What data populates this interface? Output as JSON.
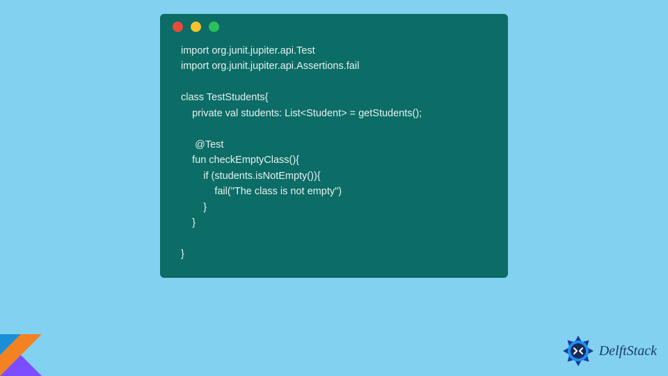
{
  "window": {
    "dots": [
      "red",
      "yellow",
      "green"
    ]
  },
  "code": {
    "lines": [
      "import org.junit.jupiter.api.Test",
      "import org.junit.jupiter.api.Assertions.fail",
      "",
      "class TestStudents{",
      "    private val students: List<Student> = getStudents();",
      "",
      "     @Test",
      "    fun checkEmptyClass(){",
      "        if (students.isNotEmpty()){",
      "            fail(\"The class is not empty\")",
      "        }",
      "    }",
      "",
      "}"
    ]
  },
  "branding": {
    "delftstack_label": "DelftStack",
    "kotlin_colors": {
      "orange": "#f58220",
      "purple": "#7c4dff",
      "blue_grad_top": "#3ddc84",
      "pink": "#e24462"
    },
    "ds_colors": {
      "outer": "#1a3a8f",
      "petal": "#1890ff",
      "center": "#1b2a56",
      "arrow": "#ffffff"
    }
  }
}
